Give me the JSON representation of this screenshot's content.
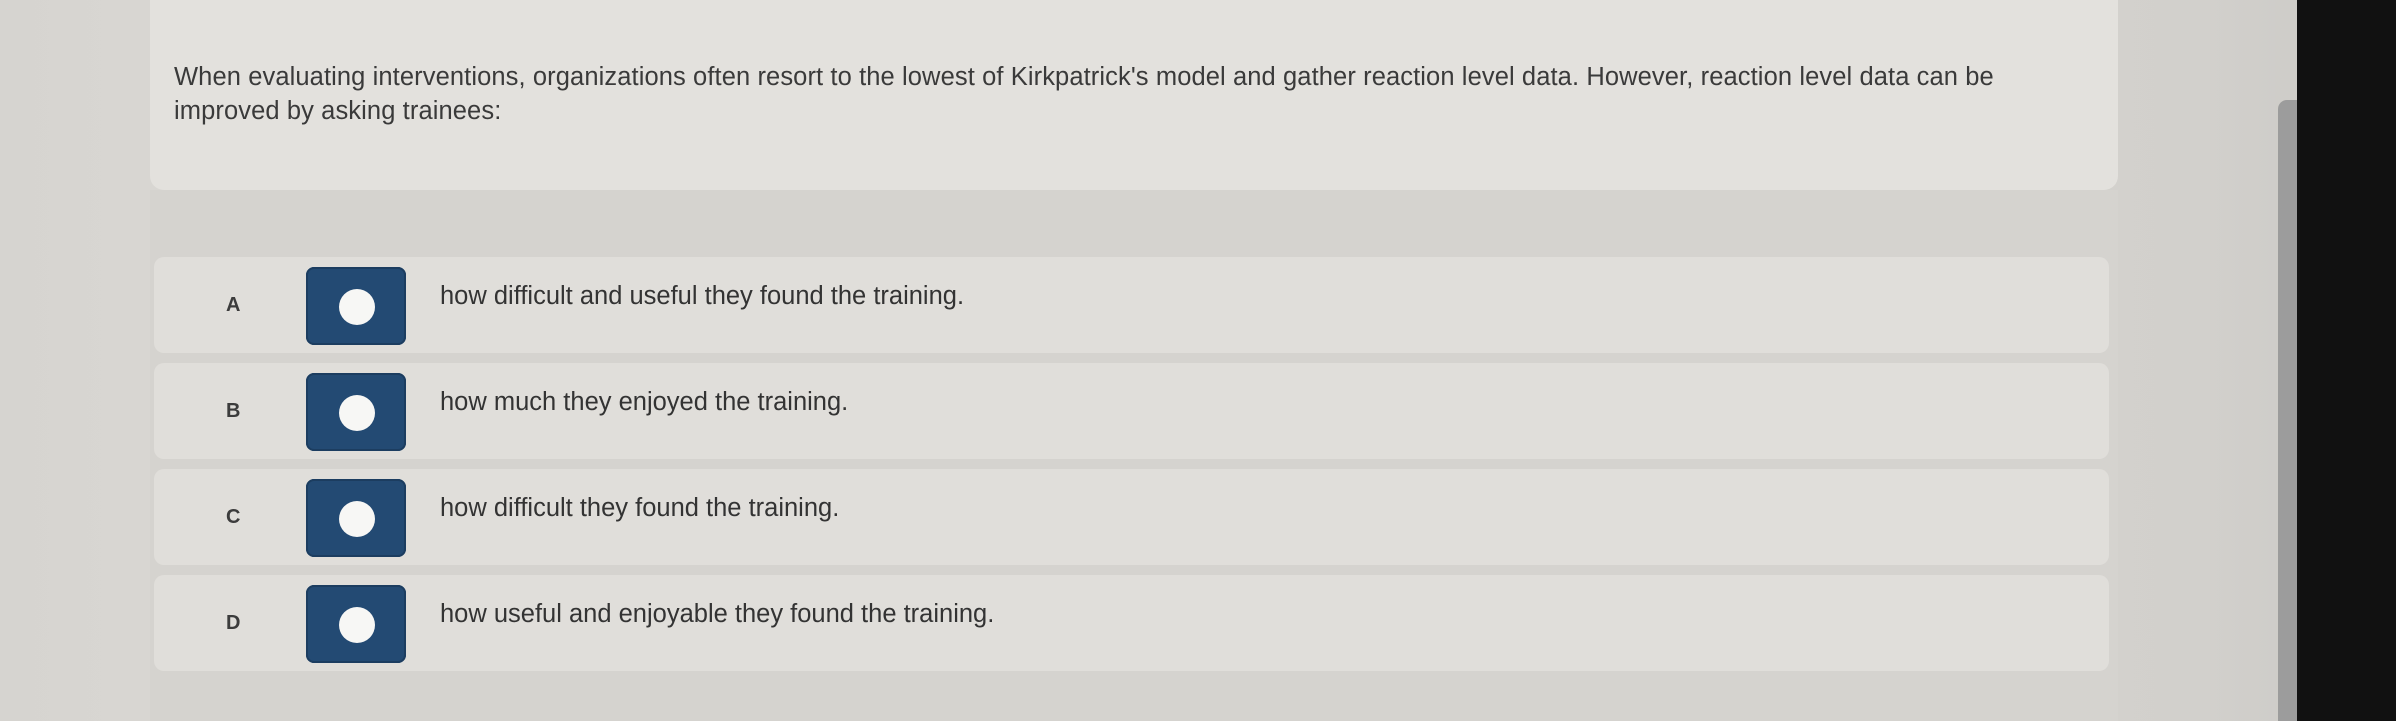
{
  "question": {
    "text": "When evaluating interventions, organizations often resort to the lowest of Kirkpatrick's model and gather reaction level data. However, reaction level data can be improved by asking trainees:"
  },
  "options": [
    {
      "letter": "A",
      "text": "how difficult and useful they found the training."
    },
    {
      "letter": "B",
      "text": "how much they enjoyed the training."
    },
    {
      "letter": "C",
      "text": "how difficult they found the training."
    },
    {
      "letter": "D",
      "text": "how useful and enjoyable they found the training."
    }
  ],
  "colors": {
    "radio_box": "#234a73",
    "radio_circle": "#f7f7f5",
    "card_background": "#e3e1dd",
    "text": "#333333"
  },
  "icons": {
    "radio": "radio-button-icon"
  }
}
